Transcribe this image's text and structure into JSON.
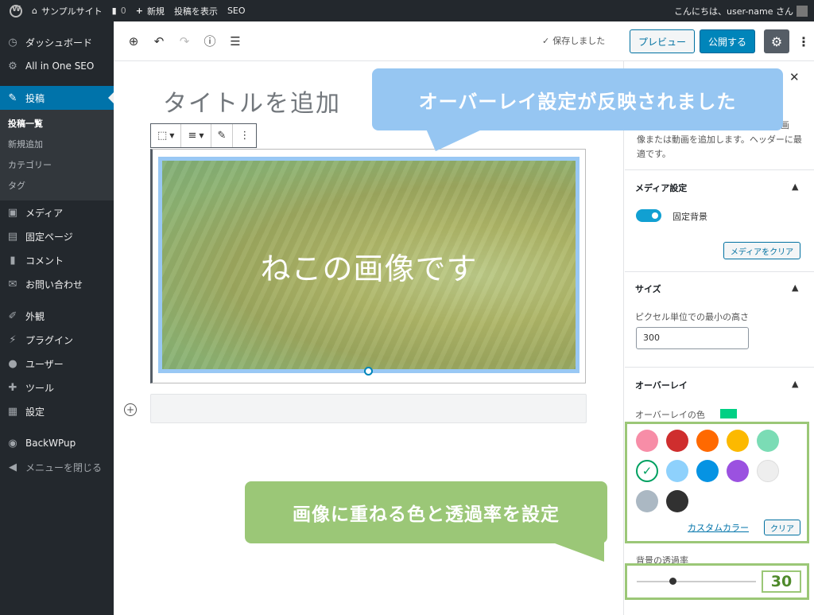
{
  "admin_bar": {
    "site_name": "サンプルサイト",
    "comments_count": "0",
    "new_label": "新規",
    "view_post_label": "投稿を表示",
    "seo_label": "SEO",
    "greeting": "こんにちは、user-name さん"
  },
  "sidebar": {
    "dashboard": "ダッシュボード",
    "aioseo": "All in One SEO",
    "posts": "投稿",
    "posts_sub": [
      "投稿一覧",
      "新規追加",
      "カテゴリー",
      "タグ"
    ],
    "media": "メディア",
    "pages": "固定ページ",
    "comments": "コメント",
    "contact": "お問い合わせ",
    "appearance": "外観",
    "plugins": "プラグイン",
    "users": "ユーザー",
    "tools": "ツール",
    "settings": "設定",
    "backwpup": "BackWPup",
    "collapse": "メニューを閉じる"
  },
  "editor_header": {
    "saved_label": "保存しました",
    "preview_label": "プレビュー",
    "publish_label": "公開する"
  },
  "editor": {
    "title_placeholder": "タイトルを追加",
    "cover_text": "ねこの画像です"
  },
  "settings_panel": {
    "block_description": "像または動画を追加します。ヘッダーに最適です。",
    "block_description_cut": "画",
    "media_settings": {
      "title": "メディア設定",
      "fixed_bg_label": "固定背景",
      "fixed_bg_on": true,
      "clear_media_label": "メディアをクリア"
    },
    "size": {
      "title": "サイズ",
      "min_height_label": "ピクセル単位での最小の高さ",
      "min_height_value": "300"
    },
    "overlay": {
      "title": "オーバーレイ",
      "color_label": "オーバーレイの色",
      "selected_color": "#00d084",
      "palette": [
        "#f78da7",
        "#cf2e2e",
        "#ff6900",
        "#fcb900",
        "#7bdcb5",
        "#00d084",
        "#8ed1fc",
        "#0693e3",
        "#9b51e0",
        "#eeeeee",
        "#abb8c3",
        "#313131"
      ],
      "custom_color_label": "カスタムカラー",
      "clear_label": "クリア"
    },
    "opacity": {
      "label": "背景の透過率",
      "value": "30",
      "value_fraction": 0.3
    }
  },
  "callouts": {
    "blue": "オーバーレイ設定が反映されました",
    "green": "画像に重ねる色と透過率を設定"
  },
  "accent_colors": {
    "wp_blue": "#0073aa",
    "admin_dark": "#23282d",
    "callout_blue": "#96c6f2",
    "callout_green": "#9bc777"
  }
}
